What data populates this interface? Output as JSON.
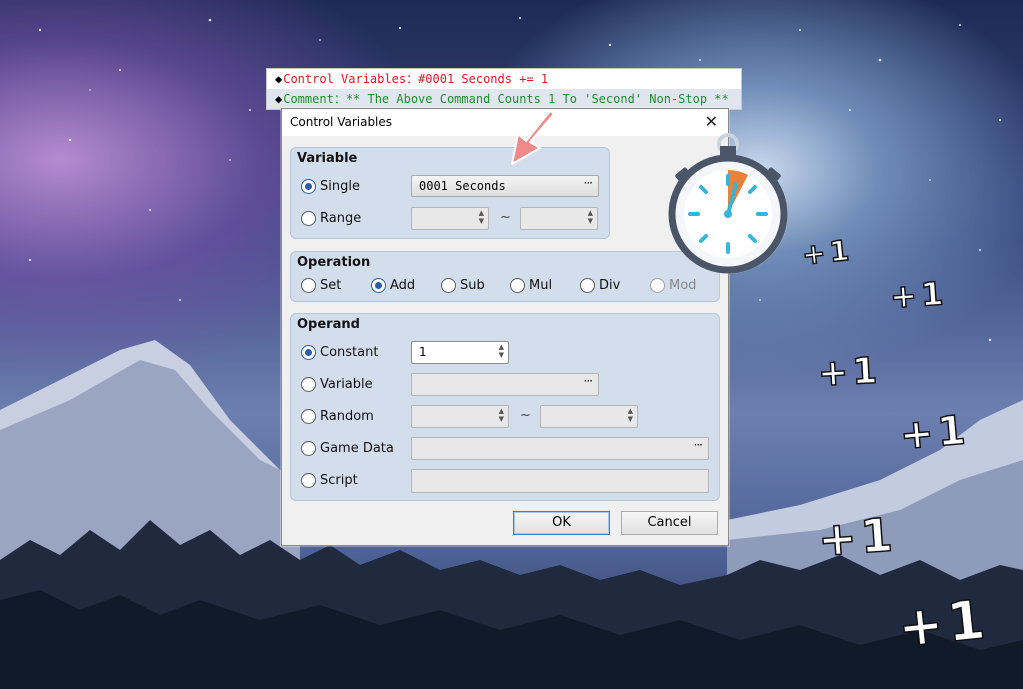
{
  "command_list": {
    "lines": [
      {
        "label": "Control Variables",
        "text": "：#0001 Seconds += 1",
        "color": "#d02020"
      },
      {
        "label": "Comment",
        "text": "：** The Above Command Counts 1 To 'Second' Non-Stop **",
        "color": "#1f8f2f"
      }
    ],
    "bullet": "◆"
  },
  "dialog": {
    "title": "Control Variables",
    "close_icon": "close-icon",
    "variable": {
      "title": "Variable",
      "single_label": "Single",
      "single_value": "0001 Seconds",
      "range_label": "Range",
      "range_sep": "~",
      "selected": "Single"
    },
    "operation": {
      "title": "Operation",
      "options": [
        "Set",
        "Add",
        "Sub",
        "Mul",
        "Div",
        "Mod"
      ],
      "selected": "Add",
      "disabled": [
        "Mod"
      ]
    },
    "operand": {
      "title": "Operand",
      "constant_label": "Constant",
      "constant_value": "1",
      "variable_label": "Variable",
      "random_label": "Random",
      "random_sep": "~",
      "game_data_label": "Game Data",
      "script_label": "Script",
      "selected": "Constant"
    },
    "ok_label": "OK",
    "cancel_label": "Cancel",
    "browse_glyph": "···"
  },
  "decorations": {
    "stopwatch_icon": "stopwatch-icon",
    "arrow_icon": "pointer-arrow-icon",
    "plus_one_text": "+1",
    "accent": "#e8813a",
    "arrow_color": "#f08a8a"
  }
}
